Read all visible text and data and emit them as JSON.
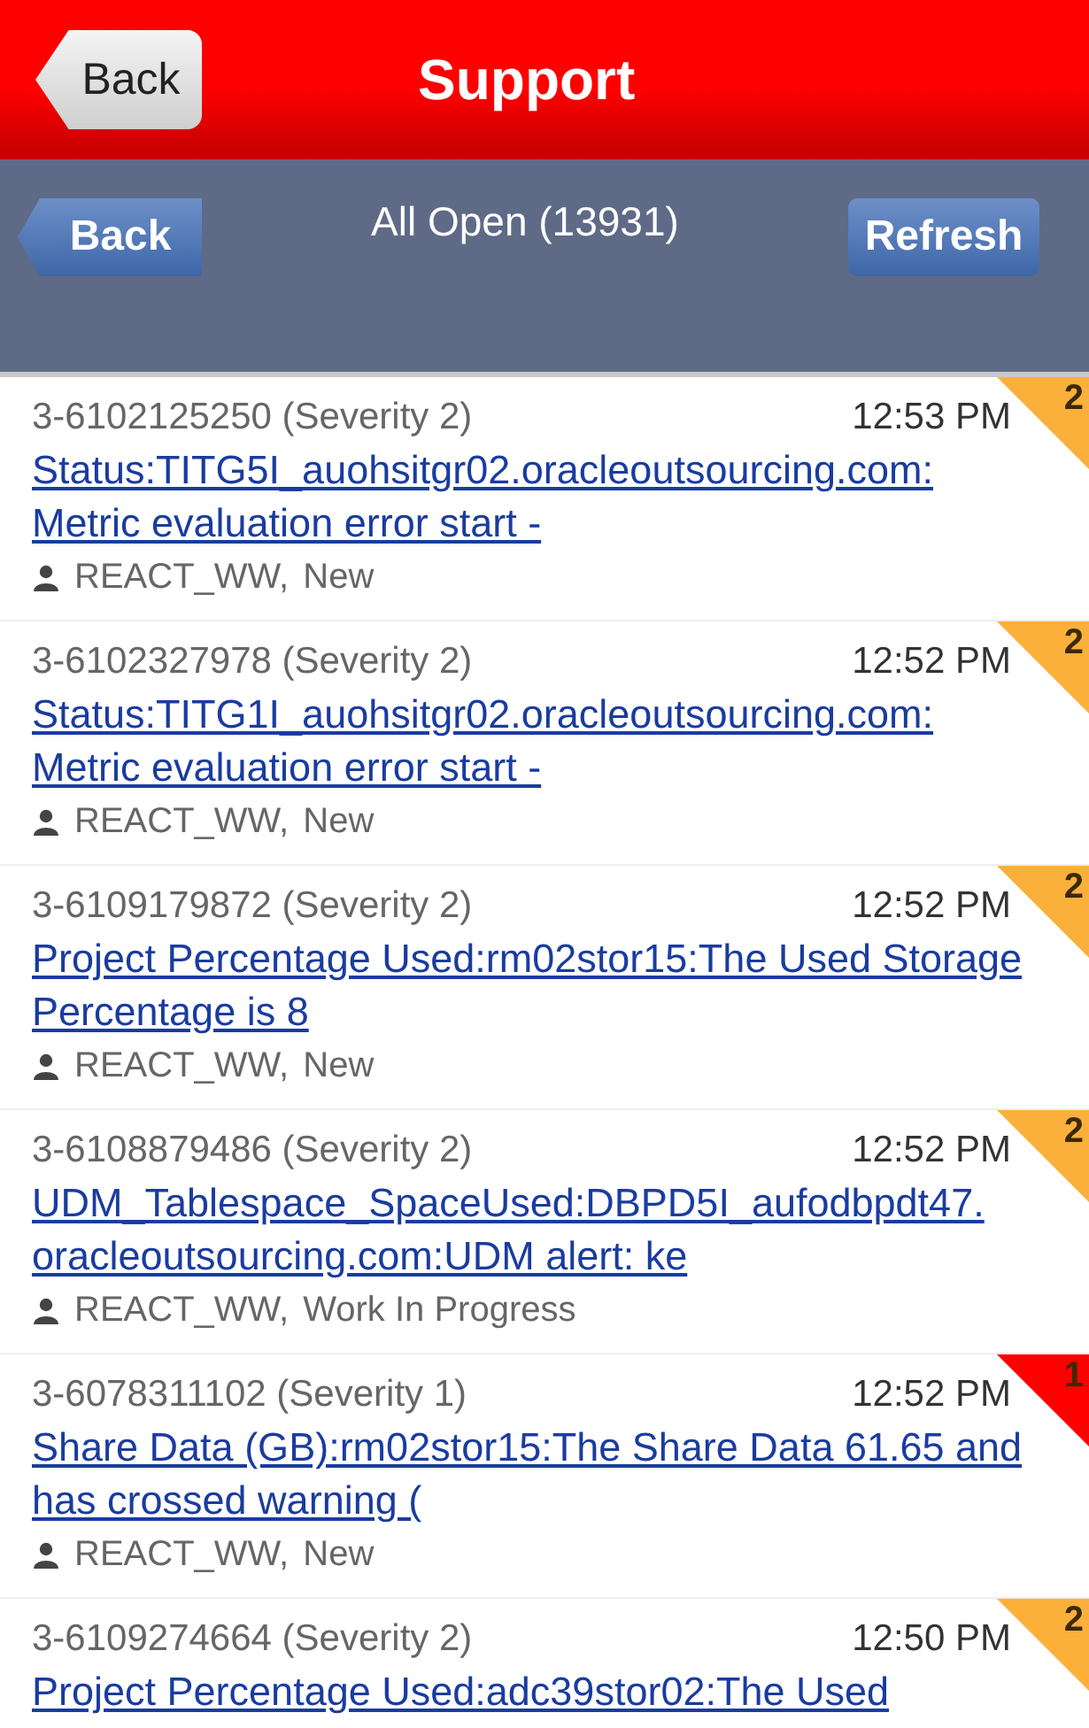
{
  "header": {
    "back": "Back",
    "title": "Support"
  },
  "subheader": {
    "back": "Back",
    "title": "All Open (13931)",
    "refresh": "Refresh"
  },
  "items": [
    {
      "id": "3-6102125250 (Severity 2)",
      "time": "12:53 PM",
      "title": "Status:TITG5I_auohsitgr02.oracleoutsourcing.com: Metric evaluation error start -",
      "owner": "REACT_WW,",
      "status": "New",
      "badge": "2",
      "color": "#fbb03b"
    },
    {
      "id": "3-6102327978 (Severity 2)",
      "time": "12:52 PM",
      "title": "Status:TITG1I_auohsitgr02.oracleoutsourcing.com: Metric evaluation error start -",
      "owner": "REACT_WW,",
      "status": "New",
      "badge": "2",
      "color": "#fbb03b"
    },
    {
      "id": "3-6109179872 (Severity 2)",
      "time": "12:52 PM",
      "title": "Project Percentage Used:rm02stor15:The Used Storage Percentage is 8",
      "owner": "REACT_WW,",
      "status": "New",
      "badge": "2",
      "color": "#fbb03b"
    },
    {
      "id": "3-6108879486 (Severity 2)",
      "time": "12:52 PM",
      "title": "UDM_Tablespace_SpaceUsed:DBPD5I_aufodbpdt47. oracleoutsourcing.com:UDM alert: ke",
      "owner": "REACT_WW,",
      "status": "Work In Progress",
      "badge": "2",
      "color": "#fbb03b"
    },
    {
      "id": "3-6078311102 (Severity 1)",
      "time": "12:52 PM",
      "title": "Share Data (GB):rm02stor15:The Share Data 61.65 and has crossed warning (",
      "owner": "REACT_WW,",
      "status": "New",
      "badge": "1",
      "color": "#ff0000"
    },
    {
      "id": "3-6109274664 (Severity 2)",
      "time": "12:50 PM",
      "title": "Project Percentage Used:adc39stor02:The Used",
      "badge": "2",
      "color": "#fbb03b"
    }
  ]
}
